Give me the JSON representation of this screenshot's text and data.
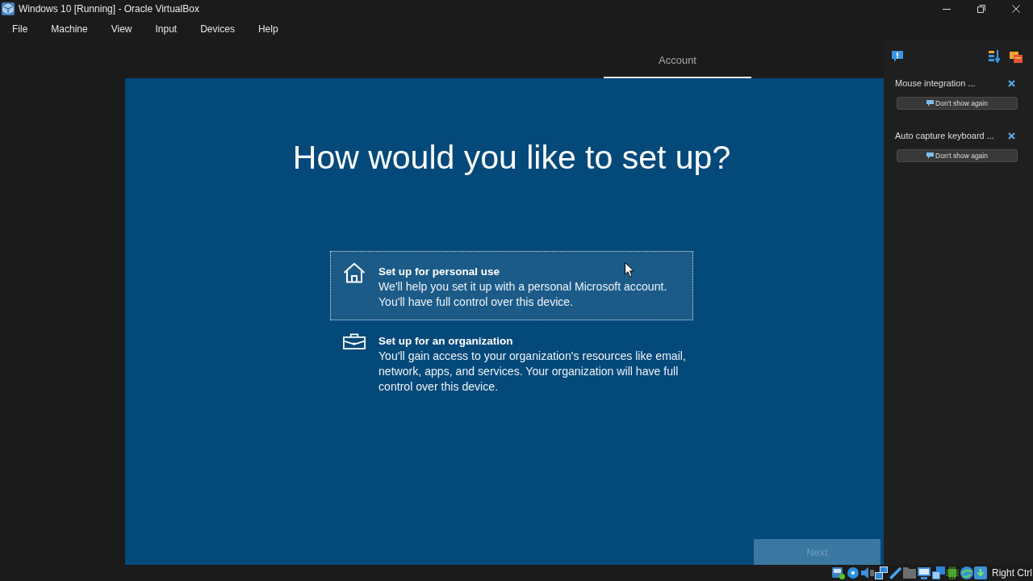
{
  "window": {
    "title": "Windows 10 [Running] - Oracle VirtualBox"
  },
  "menu": [
    "File",
    "Machine",
    "View",
    "Input",
    "Devices",
    "Help"
  ],
  "vm_screen": {
    "tabs": [
      {
        "label": "Account",
        "selected": true
      }
    ],
    "heading": "How would you like to set up?",
    "options": [
      {
        "kind": "personal",
        "title": "Set up for personal use",
        "description": "We'll help you set it up with a personal Microsoft account. You'll have full control over this device.",
        "selected": true
      },
      {
        "kind": "organization",
        "title": "Set up for an organization",
        "description": "You'll gain access to your organization's resources like email, network, apps, and services. Your organization will have full control over this device.",
        "selected": false
      }
    ],
    "next_button": {
      "label": "Next",
      "disabled": true
    }
  },
  "notifications": [
    {
      "title": "Mouse integration ...",
      "button": "Don't show again"
    },
    {
      "title": "Auto capture keyboard ...",
      "button": "Don't show again"
    }
  ],
  "status_bar": {
    "host_key": "Right Ctrl"
  }
}
